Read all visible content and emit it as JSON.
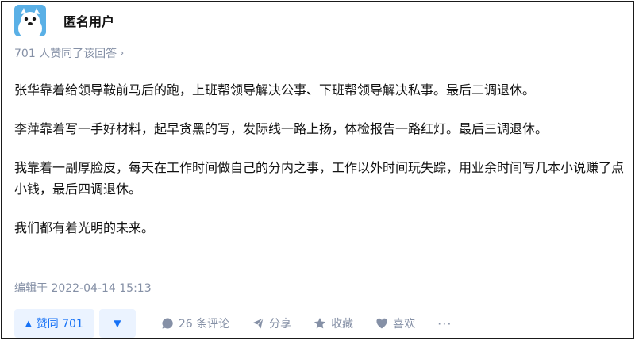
{
  "author": {
    "name": "匿名用户"
  },
  "likes_summary": {
    "text": "701 人赞同了该回答",
    "chevron": "›"
  },
  "answer": {
    "paragraphs": [
      "张华靠着给领导鞍前马后的跑，上班帮领导解决公事、下班帮领导解决私事。最后二调退休。",
      "李萍靠着写一手好材料，起早贪黑的写，发际线一路上扬，体检报告一路红灯。最后三调退休。",
      "我靠着一副厚脸皮，每天在工作时间做自己的分内之事，工作以外时间玩失踪，用业余时间写几本小说赚了点小钱，最后四调退休。",
      "我们都有着光明的未来。"
    ]
  },
  "edited": "编辑于 2022-04-14 15:13",
  "actions": {
    "upvote_label": "赞同 701",
    "upvote_icon": "▲",
    "downvote_icon": "▼",
    "comment_label": "26 条评论",
    "share_label": "分享",
    "favorite_label": "收藏",
    "like_label": "喜欢",
    "more_label": "···"
  },
  "colors": {
    "accent": "#1772f6",
    "accent_bg": "#ebf3ff",
    "muted": "#8590a6",
    "avatar": "#5ab0e6"
  }
}
